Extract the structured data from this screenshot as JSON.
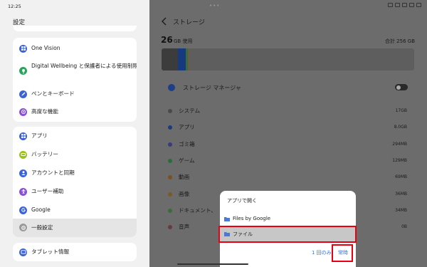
{
  "status": {
    "time": "12:25"
  },
  "settings": {
    "title": "設定",
    "group1": [
      {
        "label": "One Vision",
        "icon": "one-vision-icon"
      },
      {
        "label": "Digital Wellbeing と保護者による使用制限",
        "icon": "wellbeing-icon"
      },
      {
        "label": "ペンとキーボード",
        "icon": "pen-icon"
      },
      {
        "label": "高度な機能",
        "icon": "advanced-icon"
      }
    ],
    "group2": [
      {
        "label": "アプリ",
        "icon": "apps-icon"
      },
      {
        "label": "バッテリー",
        "icon": "battery-icon"
      },
      {
        "label": "アカウントと同期",
        "icon": "account-icon"
      },
      {
        "label": "ユーザー補助",
        "icon": "accessibility-icon"
      },
      {
        "label": "Google",
        "icon": "google-icon"
      },
      {
        "label": "一般設定",
        "icon": "general-settings-icon"
      }
    ],
    "group3": [
      {
        "label": "タブレット情報",
        "icon": "tablet-info-icon"
      }
    ]
  },
  "storage": {
    "title": "ストレージ",
    "used_number": "26",
    "used_unit": "GB 使用",
    "total": "合計 256 GB",
    "manager_label": "ストレージ マネージャ",
    "bar_segments": [
      {
        "color": "#3c3c3c",
        "fraction": 0.066
      },
      {
        "color": "#173a7e",
        "fraction": 0.03
      },
      {
        "color": "#3a6a3e",
        "fraction": 0.008
      },
      {
        "color": "#7a5a2a",
        "fraction": 0.004
      }
    ],
    "categories": [
      {
        "name": "システム",
        "size": "17GB",
        "color": "#4a4a4a"
      },
      {
        "name": "アプリ",
        "size": "8.0GB",
        "color": "#1b3a80"
      },
      {
        "name": "ゴミ箱",
        "size": "294MB",
        "color": "#3a3a80"
      },
      {
        "name": "ゲーム",
        "size": "129MB",
        "color": "#2d6b3b"
      },
      {
        "name": "動画",
        "size": "69MB",
        "color": "#7a4f22"
      },
      {
        "name": "画像",
        "size": "36MB",
        "color": "#7a5a22"
      },
      {
        "name": "ドキュメント、",
        "size": "34MB",
        "color": "#3d6a3a"
      },
      {
        "name": "音声",
        "size": "0B",
        "color": "#6a3a3a"
      }
    ]
  },
  "sheet": {
    "title": "アプリで開く",
    "options": [
      {
        "label": "Files by Google",
        "icon": "files-by-google-icon"
      },
      {
        "label": "ファイル",
        "icon": "folder-icon"
      }
    ],
    "once_label": "1 回のみ",
    "always_label": "常時"
  }
}
